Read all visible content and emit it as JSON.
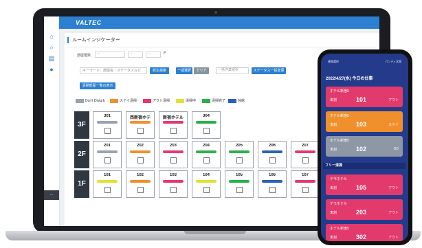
{
  "app": {
    "logo": "VALTEC",
    "page_title": "ルームインジケーター"
  },
  "filters": {
    "building_label": "部屋階数",
    "select_placeholder": "---",
    "floor_suffix": "F",
    "search_placeholder": "キーワード：部屋名・ステータスなど",
    "search_button": "絞込検索",
    "bulk_select": "一括選択",
    "clear": "クリア",
    "action_select": "一括作業選択",
    "status_update": "ステータス一括変更",
    "checked_list": "清掃部屋一覧の表示"
  },
  "colors": {
    "gray": "#9aa3ad",
    "orange": "#f0902d",
    "pink": "#e5396e",
    "yellow": "#e2e132",
    "green": "#29b24a",
    "blue": "#2a63b6"
  },
  "legend": [
    {
      "label": "Don't Disturb",
      "color": "gray"
    },
    {
      "label": "ステイ清掃",
      "color": "orange"
    },
    {
      "label": "アウト清掃",
      "color": "pink"
    },
    {
      "label": "清掃中",
      "color": "yellow"
    },
    {
      "label": "清掃完了",
      "color": "green"
    },
    {
      "label": "休館",
      "color": "blue"
    }
  ],
  "floors": [
    {
      "label": "3F",
      "rooms": [
        {
          "name": "301",
          "color": "gray"
        },
        {
          "name": "西新宿ホテ",
          "color": "orange"
        },
        {
          "name": "新宿ホテル",
          "color": "pink"
        },
        {
          "name": "304",
          "color": "green"
        }
      ]
    },
    {
      "label": "2F",
      "rooms": [
        {
          "name": "201",
          "color": "gray"
        },
        {
          "name": "202",
          "color": "orange"
        },
        {
          "name": "203",
          "color": "pink"
        },
        {
          "name": "204",
          "color": "green"
        },
        {
          "name": "205",
          "color": "green"
        },
        {
          "name": "206",
          "color": "blue"
        },
        {
          "name": "207",
          "color": "pink"
        }
      ]
    },
    {
      "label": "1F",
      "rooms": [
        {
          "name": "101",
          "color": "yellow"
        },
        {
          "name": "102",
          "color": "orange"
        },
        {
          "name": "103",
          "color": "pink"
        },
        {
          "name": "104",
          "color": "yellow"
        },
        {
          "name": "105",
          "color": "green"
        },
        {
          "name": "106",
          "color": "blue"
        },
        {
          "name": "107",
          "color": "pink"
        }
      ]
    }
  ],
  "phone": {
    "status_left": "建物選択",
    "status_right": "パンディ本館",
    "date_heading": "2022/4/27(水) 今日の仕事",
    "free_section": "フリー清掃",
    "cards_top": [
      {
        "hotel": "ホテル新宿5",
        "status": "未割",
        "room": "101",
        "type": "アウト",
        "color": "#e23a6c"
      },
      {
        "hotel": "ホテル新宿5",
        "status": "未割",
        "room": "103",
        "type": "ステイ",
        "color": "#f0902d"
      },
      {
        "hotel": "ホテル新宿5",
        "status": "未割",
        "room": "102",
        "type": "DD",
        "color": "#8e97a5"
      }
    ],
    "cards_bottom": [
      {
        "hotel": "デモホテル",
        "status": "未割",
        "room": "105",
        "type": "アウト",
        "color": "#e23a6c"
      },
      {
        "hotel": "デモホテル",
        "status": "未割",
        "room": "203",
        "type": "アウト",
        "color": "#e23a6c"
      },
      {
        "hotel": "ホテル新宿5",
        "status": "未割",
        "room": "302",
        "type": "アウト",
        "color": "#e23a6c"
      }
    ]
  }
}
